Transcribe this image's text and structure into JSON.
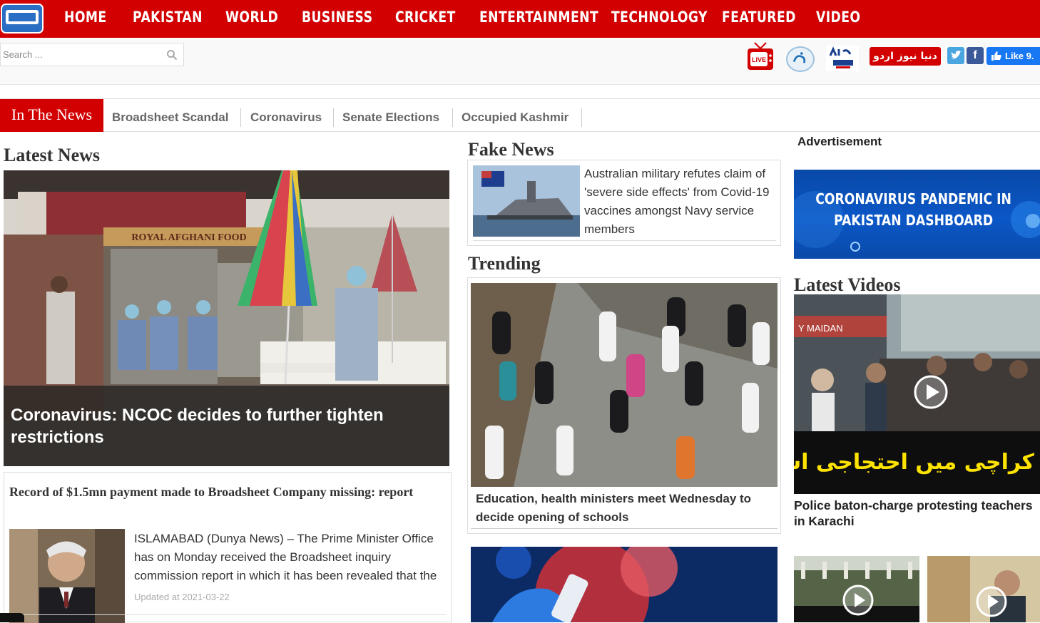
{
  "nav": {
    "items": [
      "HOME",
      "PAKISTAN",
      "WORLD",
      "BUSINESS",
      "CRICKET",
      "ENTERTAINMENT",
      "TECHNOLOGY",
      "FEATURED",
      "VIDEO"
    ]
  },
  "toolbar": {
    "search_placeholder": "Search ...",
    "live_label": "LIVE",
    "urdu_label": "دنیا نیوز اردو",
    "like_label": "Like 9.",
    "fb_label": "f"
  },
  "in_the_news": {
    "label": "In The News",
    "links": [
      "Broadsheet Scandal",
      "Coronavirus",
      "Senate Elections",
      "Occupied Kashmir"
    ]
  },
  "latest_news": {
    "heading": "Latest News",
    "hero_sign": "ROYAL AFGHANI FOOD",
    "hero_title": "Coronavirus: NCOC decides to further tighten restrictions",
    "card_title": "Record of $1.5mn payment made to Broadsheet Company missing: report",
    "card_text": "ISLAMABAD (Dunya News) – The Prime Minister Office has on Monday received the Broadsheet inquiry commission report in which it has been revealed that the",
    "card_date": "Updated at 2021-03-22"
  },
  "fake_news": {
    "heading": "Fake News",
    "text": "Australian military refutes claim of 'severe side effects' from Covid-19 vaccines amongst Navy service members"
  },
  "trending": {
    "heading": "Trending",
    "text": "Education, health ministers meet Wednesday to decide opening of schools"
  },
  "advertisement": {
    "label": "Advertisement",
    "banner_text": "CORONAVIRUS PANDEMIC IN PAKISTAN DASHBOARD"
  },
  "latest_videos": {
    "heading": "Latest Videos",
    "urdu_caption": "کراچی میں احتجاجی اساتذہ پر پولیس کا لاٹھی چارج",
    "van_sign": "Y MAIDAN",
    "title_line1": "Police baton-charge protesting teachers",
    "title_line2": "in Karachi"
  },
  "colors": {
    "brand_red": "#d20000",
    "facebook_blue": "#3b5998",
    "like_blue": "#1877f2",
    "twitter_blue": "#4aa6e0"
  }
}
